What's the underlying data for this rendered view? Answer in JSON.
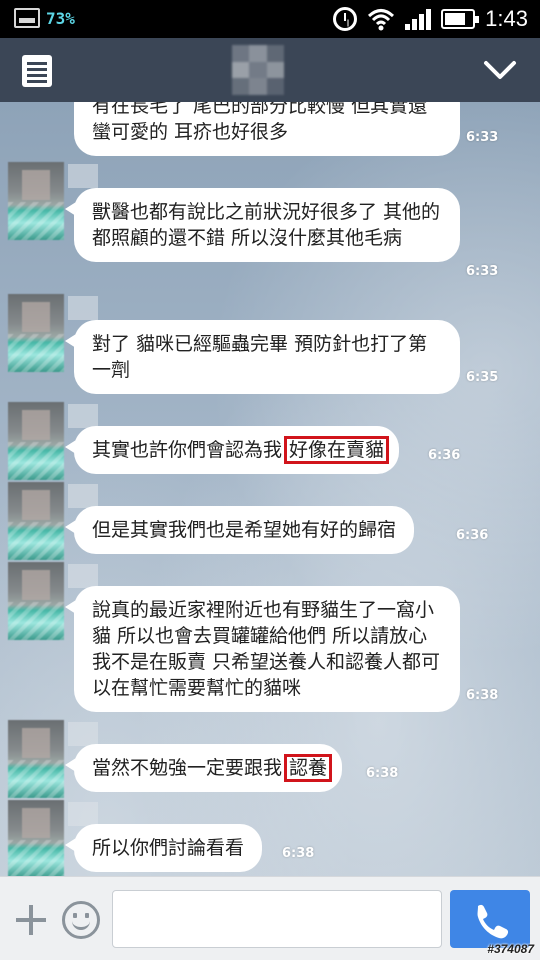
{
  "status_bar": {
    "battery_percent": "73%",
    "time": "1:43",
    "icons": [
      "gallery-icon",
      "alarm-icon",
      "wifi-icon",
      "signal-icon",
      "battery-icon"
    ]
  },
  "header": {
    "menu_icon": "notes-icon",
    "collapse_icon": "chevron-down-icon"
  },
  "messages": [
    {
      "text": "有在長毛了 尾巴的部分比較慢 但其實還蠻可愛的 耳疥也好很多",
      "time": "6:33"
    },
    {
      "text": "獸醫也都有說比之前狀況好很多了 其他的都照顧的還不錯 所以沒什麼其他毛病",
      "time": "6:33"
    },
    {
      "text": "對了 貓咪已經驅蟲完畢 預防針也打了第一劑",
      "time": "6:35"
    },
    {
      "text_before": "其實也許你們會認為我",
      "text_highlight": "好像在賣貓",
      "time": "6:36"
    },
    {
      "text": "但是其實我們也是希望她有好的歸宿",
      "time": "6:36"
    },
    {
      "text": "說真的最近家裡附近也有野貓生了一窩小貓 所以也會去買罐罐給他們 所以請放心 我不是在販賣 只希望送養人和認養人都可以在幫忙需要幫忙的貓咪",
      "time": "6:38"
    },
    {
      "text_before": "當然不勉強一定要跟我",
      "text_highlight": "認養",
      "time": "6:38"
    },
    {
      "text": "所以你們討論看看",
      "time": "6:38"
    }
  ],
  "input_bar": {
    "message_value": "",
    "call_icon": "phone-icon"
  },
  "watermark": "#374087"
}
